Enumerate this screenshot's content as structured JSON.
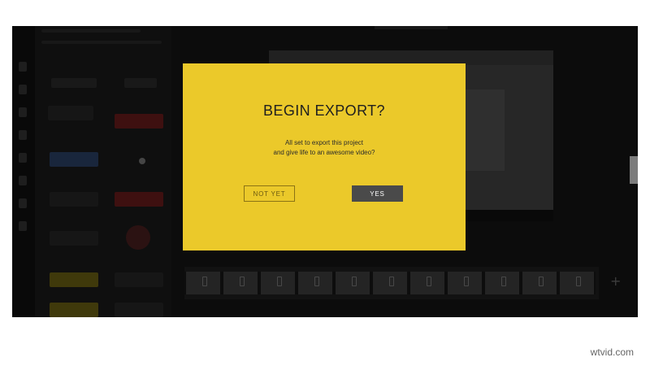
{
  "dialog": {
    "title": "BEGIN EXPORT?",
    "message_line_1": "All set to export this project",
    "message_line_2": "and give life to an awesome video?",
    "not_yet_label": "NOT YET",
    "yes_label": "YES"
  },
  "watermark": "wtvid.com",
  "colors": {
    "dialog_background": "#ebc92a",
    "yes_button": "#4a4a4a",
    "overlay": "#000000"
  }
}
